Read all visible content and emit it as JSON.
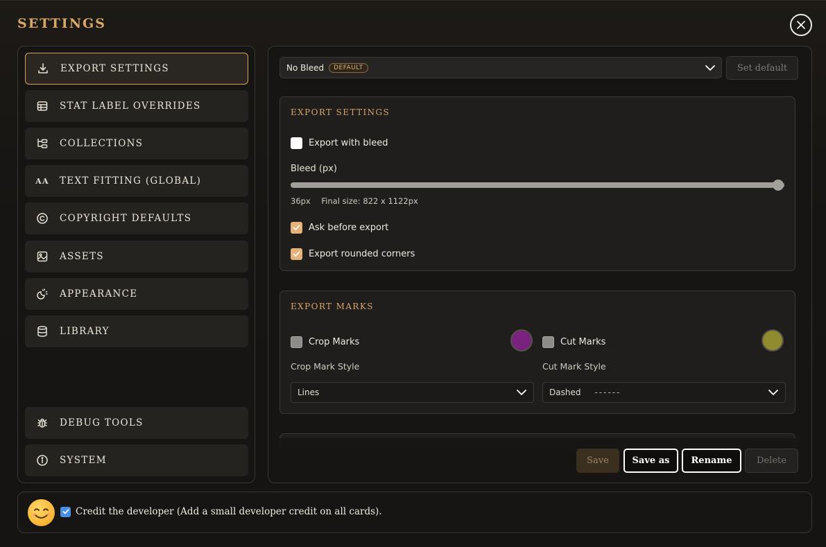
{
  "title": "SETTINGS",
  "sidebar": {
    "items": [
      {
        "label": "EXPORT SETTINGS",
        "icon": "download-icon",
        "active": true
      },
      {
        "label": "STAT LABEL OVERRIDES",
        "icon": "table-icon",
        "active": false
      },
      {
        "label": "COLLECTIONS",
        "icon": "folder-tree-icon",
        "active": false
      },
      {
        "label": "TEXT FITTING (GLOBAL)",
        "icon": "text-size-icon",
        "active": false
      },
      {
        "label": "COPYRIGHT DEFAULTS",
        "icon": "copyright-icon",
        "active": false
      },
      {
        "label": "ASSETS",
        "icon": "image-icon",
        "active": false
      },
      {
        "label": "APPEARANCE",
        "icon": "sun-moon-icon",
        "active": false
      },
      {
        "label": "LIBRARY",
        "icon": "database-icon",
        "active": false
      }
    ],
    "bottom_items": [
      {
        "label": "DEBUG TOOLS",
        "icon": "bug-icon"
      },
      {
        "label": "SYSTEM",
        "icon": "info-icon"
      }
    ],
    "text_fitting_glyph": "AA"
  },
  "preset": {
    "value": "No Bleed",
    "badge": "DEFAULT",
    "set_default_label": "Set default"
  },
  "export_settings": {
    "title": "EXPORT SETTINGS",
    "export_with_bleed": {
      "label": "Export with bleed",
      "checked": false
    },
    "bleed_label": "Bleed (px)",
    "bleed_value": "36px",
    "bleed_slider_fraction": 1.0,
    "final_size": "Final size: 822 x 1122px",
    "ask_before_export": {
      "label": "Ask before export",
      "checked": true
    },
    "export_rounded_corners": {
      "label": "Export rounded corners",
      "checked": true
    }
  },
  "export_marks": {
    "title": "EXPORT MARKS",
    "crop": {
      "label": "Crop Marks",
      "checked": false,
      "color": "#7a2280",
      "style_label": "Crop Mark Style",
      "style_value": "Lines"
    },
    "cut": {
      "label": "Cut Marks",
      "checked": false,
      "color": "#8f8b2e",
      "style_label": "Cut Mark Style",
      "style_value": "Dashed",
      "style_preview": "------"
    }
  },
  "footer": {
    "save": "Save",
    "save_as": "Save as",
    "rename": "Rename",
    "delete": "Delete"
  },
  "credit": {
    "checked": true,
    "label": "Credit the developer (Add a small developer credit on all cards)."
  },
  "colors": {
    "accent": "#d8a766",
    "checkbox_checked": "#e5b37a",
    "credit_checkbox": "#4a90e2"
  }
}
